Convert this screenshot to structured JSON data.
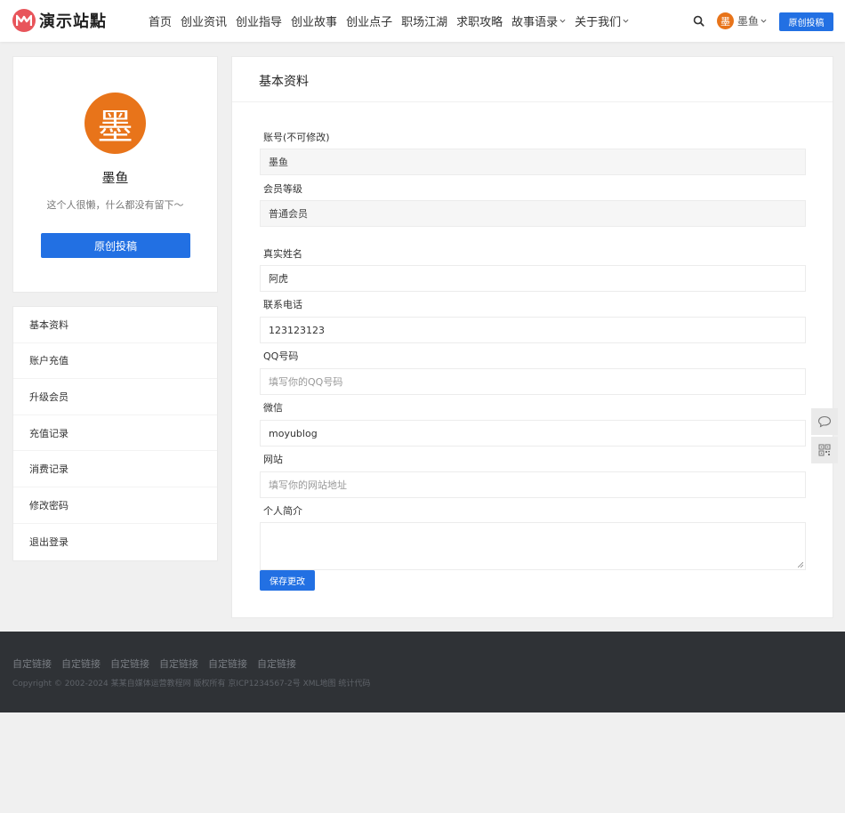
{
  "header": {
    "logo_text": "演示站點",
    "nav": [
      {
        "label": "首页",
        "has_dropdown": false
      },
      {
        "label": "创业资讯",
        "has_dropdown": false
      },
      {
        "label": "创业指导",
        "has_dropdown": false
      },
      {
        "label": "创业故事",
        "has_dropdown": false
      },
      {
        "label": "创业点子",
        "has_dropdown": false
      },
      {
        "label": "职场江湖",
        "has_dropdown": false
      },
      {
        "label": "求职攻略",
        "has_dropdown": false
      },
      {
        "label": "故事语录",
        "has_dropdown": true
      },
      {
        "label": "关于我们",
        "has_dropdown": true
      }
    ],
    "user_avatar_char": "墨",
    "user_name": "墨鱼",
    "post_button": "原创投稿"
  },
  "profile": {
    "avatar_char": "墨",
    "name": "墨鱼",
    "bio": "这个人很懒，什么都没有留下～",
    "post_button": "原创投稿"
  },
  "side_menu": [
    "基本资料",
    "账户充值",
    "升级会员",
    "充值记录",
    "消费记录",
    "修改密码",
    "退出登录"
  ],
  "main": {
    "title": "基本资料",
    "account_label": "账号(不可修改)",
    "account_value": "墨鱼",
    "level_label": "会员等级",
    "level_value": "普通会员",
    "realname_label": "真实姓名",
    "realname_value": "阿虎",
    "phone_label": "联系电话",
    "phone_value": "123123123",
    "qq_label": "QQ号码",
    "qq_placeholder": "填写你的QQ号码",
    "wechat_label": "微信",
    "wechat_value": "moyublog",
    "website_label": "网站",
    "website_placeholder": "填写你的网站地址",
    "intro_label": "个人简介",
    "intro_value": "",
    "save_button": "保存更改"
  },
  "footer": {
    "links": [
      "自定链接",
      "自定链接",
      "自定链接",
      "自定链接",
      "自定链接",
      "自定链接"
    ],
    "copyright": "Copyright © 2002-2024 某某自媒体运营教程网 版权所有 京ICP1234567-2号 XML地图 统计代码"
  },
  "colors": {
    "accent": "#2270e3",
    "avatar_orange": "#e8741a",
    "logo_red": "#e8555b",
    "footer_bg": "#2f3236"
  },
  "icons": [
    "logo-icon",
    "search-icon",
    "chevron-down-icon",
    "comment-icon",
    "qrcode-icon"
  ]
}
